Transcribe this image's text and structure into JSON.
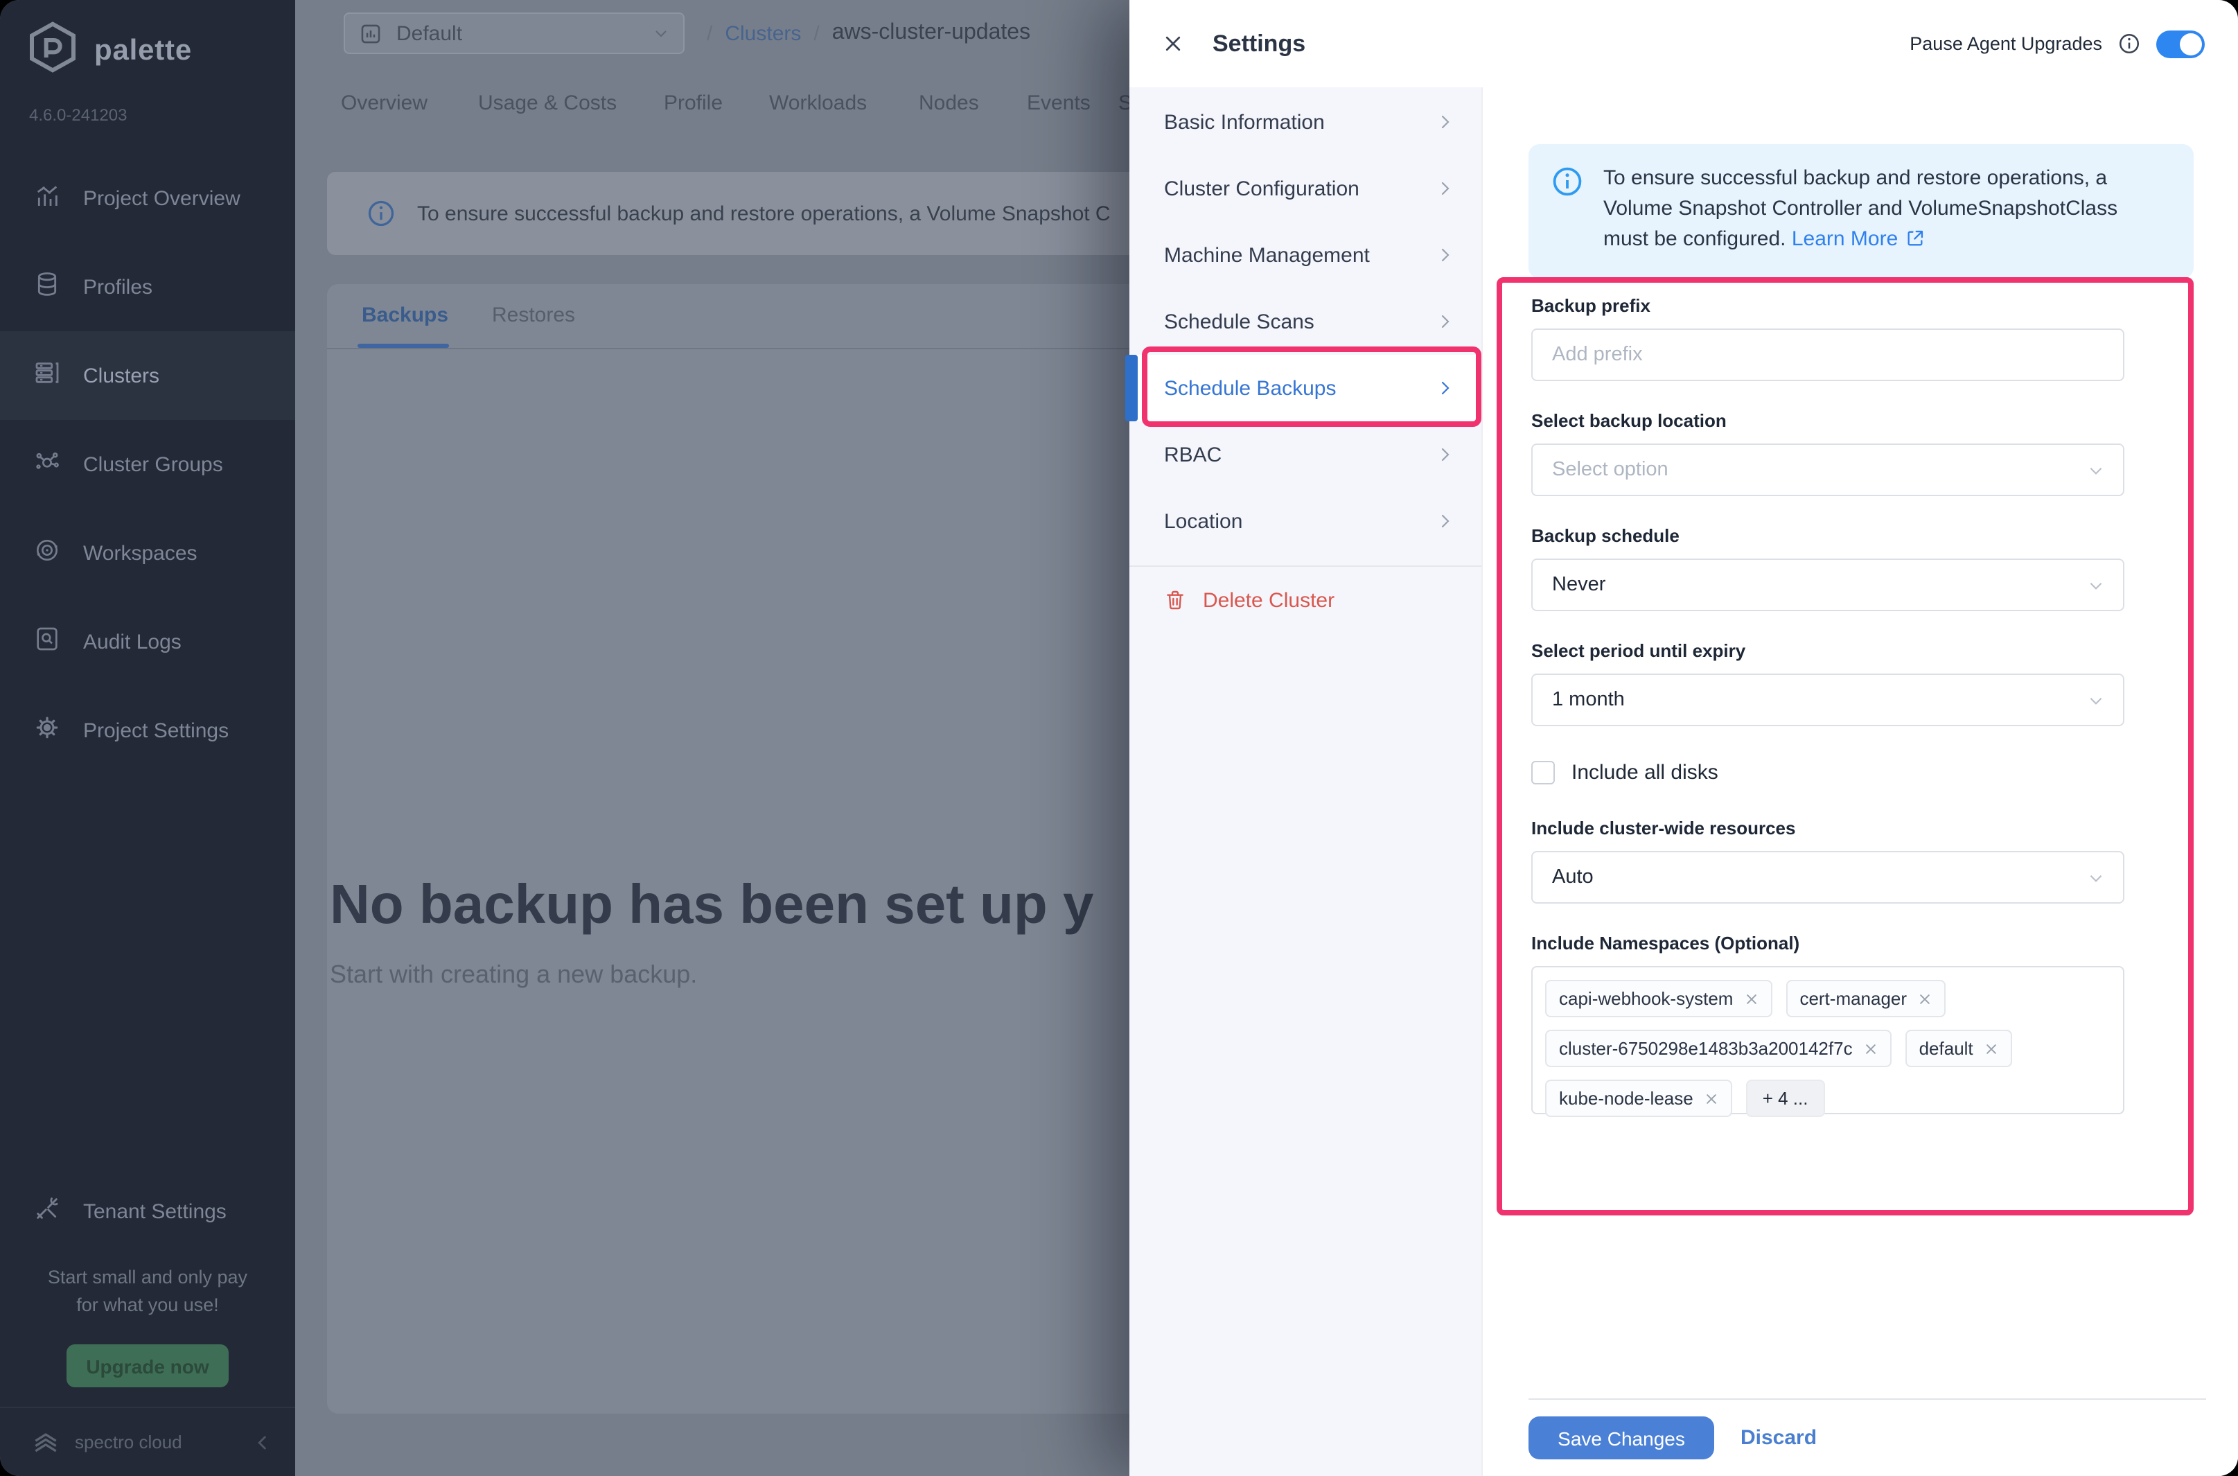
{
  "colors": {
    "annotation_pink": "#F0336F",
    "toggle_blue": "#2E86F0",
    "save_blue": "#4A80D6",
    "link_blue": "#2F80ED",
    "nav_active_blue": "#3575D4",
    "delete_red": "#D9574E",
    "sidebar_bg": "#232936",
    "upgrade_green": "#3F6E57"
  },
  "sidebar": {
    "logo_text": "palette",
    "version": "4.6.0-241203",
    "items": [
      {
        "label": "Project Overview"
      },
      {
        "label": "Profiles"
      },
      {
        "label": "Clusters"
      },
      {
        "label": "Cluster Groups"
      },
      {
        "label": "Workspaces"
      },
      {
        "label": "Audit Logs"
      },
      {
        "label": "Project Settings"
      }
    ],
    "active_item": "Clusters",
    "tenant_settings_label": "Tenant Settings",
    "promo_line1": "Start small and only pay",
    "promo_line2": "for what you use!",
    "upgrade_button": "Upgrade now",
    "footer_brand": "spectro cloud"
  },
  "topbar": {
    "project_selector": "Default",
    "breadcrumb": {
      "sep": "/",
      "root": "Clusters",
      "current": "aws-cluster-updates"
    },
    "tabs": [
      {
        "label": "Overview"
      },
      {
        "label": "Usage & Costs"
      },
      {
        "label": "Profile"
      },
      {
        "label": "Workloads"
      },
      {
        "label": "Nodes"
      },
      {
        "label": "Events"
      },
      {
        "label": "S"
      }
    ]
  },
  "main": {
    "banner_text": "To ensure successful backup and restore operations, a Volume Snapshot C",
    "tabs": {
      "backups": "Backups",
      "restores": "Restores"
    },
    "active_tab": "Backups",
    "empty_title": "No backup has been set up y",
    "empty_subtitle": "Start with creating a new backup."
  },
  "modal": {
    "title": "Settings",
    "pause_agent_upgrades_label": "Pause Agent Upgrades",
    "pause_agent_upgrades_on": true,
    "nav": [
      {
        "label": "Basic Information"
      },
      {
        "label": "Cluster Configuration"
      },
      {
        "label": "Machine Management"
      },
      {
        "label": "Schedule Scans"
      },
      {
        "label": "Schedule Backups"
      },
      {
        "label": "RBAC"
      },
      {
        "label": "Location"
      }
    ],
    "active_nav": "Schedule Backups",
    "delete_cluster_label": "Delete Cluster",
    "info_banner": {
      "text": "To ensure successful backup and restore operations, a Volume Snapshot Controller and VolumeSnapshotClass must be configured.",
      "link": "Learn More"
    },
    "form": {
      "backup_prefix": {
        "label": "Backup prefix",
        "placeholder": "Add prefix",
        "value": ""
      },
      "backup_location": {
        "label": "Select backup location",
        "placeholder": "Select option"
      },
      "backup_schedule": {
        "label": "Backup schedule",
        "value": "Never"
      },
      "expiry": {
        "label": "Select period until expiry",
        "value": "1 month"
      },
      "include_all_disks": {
        "label": "Include all disks",
        "checked": false
      },
      "cluster_wide": {
        "label": "Include cluster-wide resources",
        "value": "Auto"
      },
      "namespaces": {
        "label": "Include Namespaces (Optional)",
        "chips": [
          {
            "name": "capi-webhook-system"
          },
          {
            "name": "cert-manager"
          },
          {
            "name": "cluster-6750298e1483b3a200142f7c"
          },
          {
            "name": "default"
          },
          {
            "name": "kube-node-lease"
          }
        ],
        "more_chip": "+ 4 ..."
      }
    },
    "save_button": "Save Changes",
    "discard_button": "Discard"
  }
}
